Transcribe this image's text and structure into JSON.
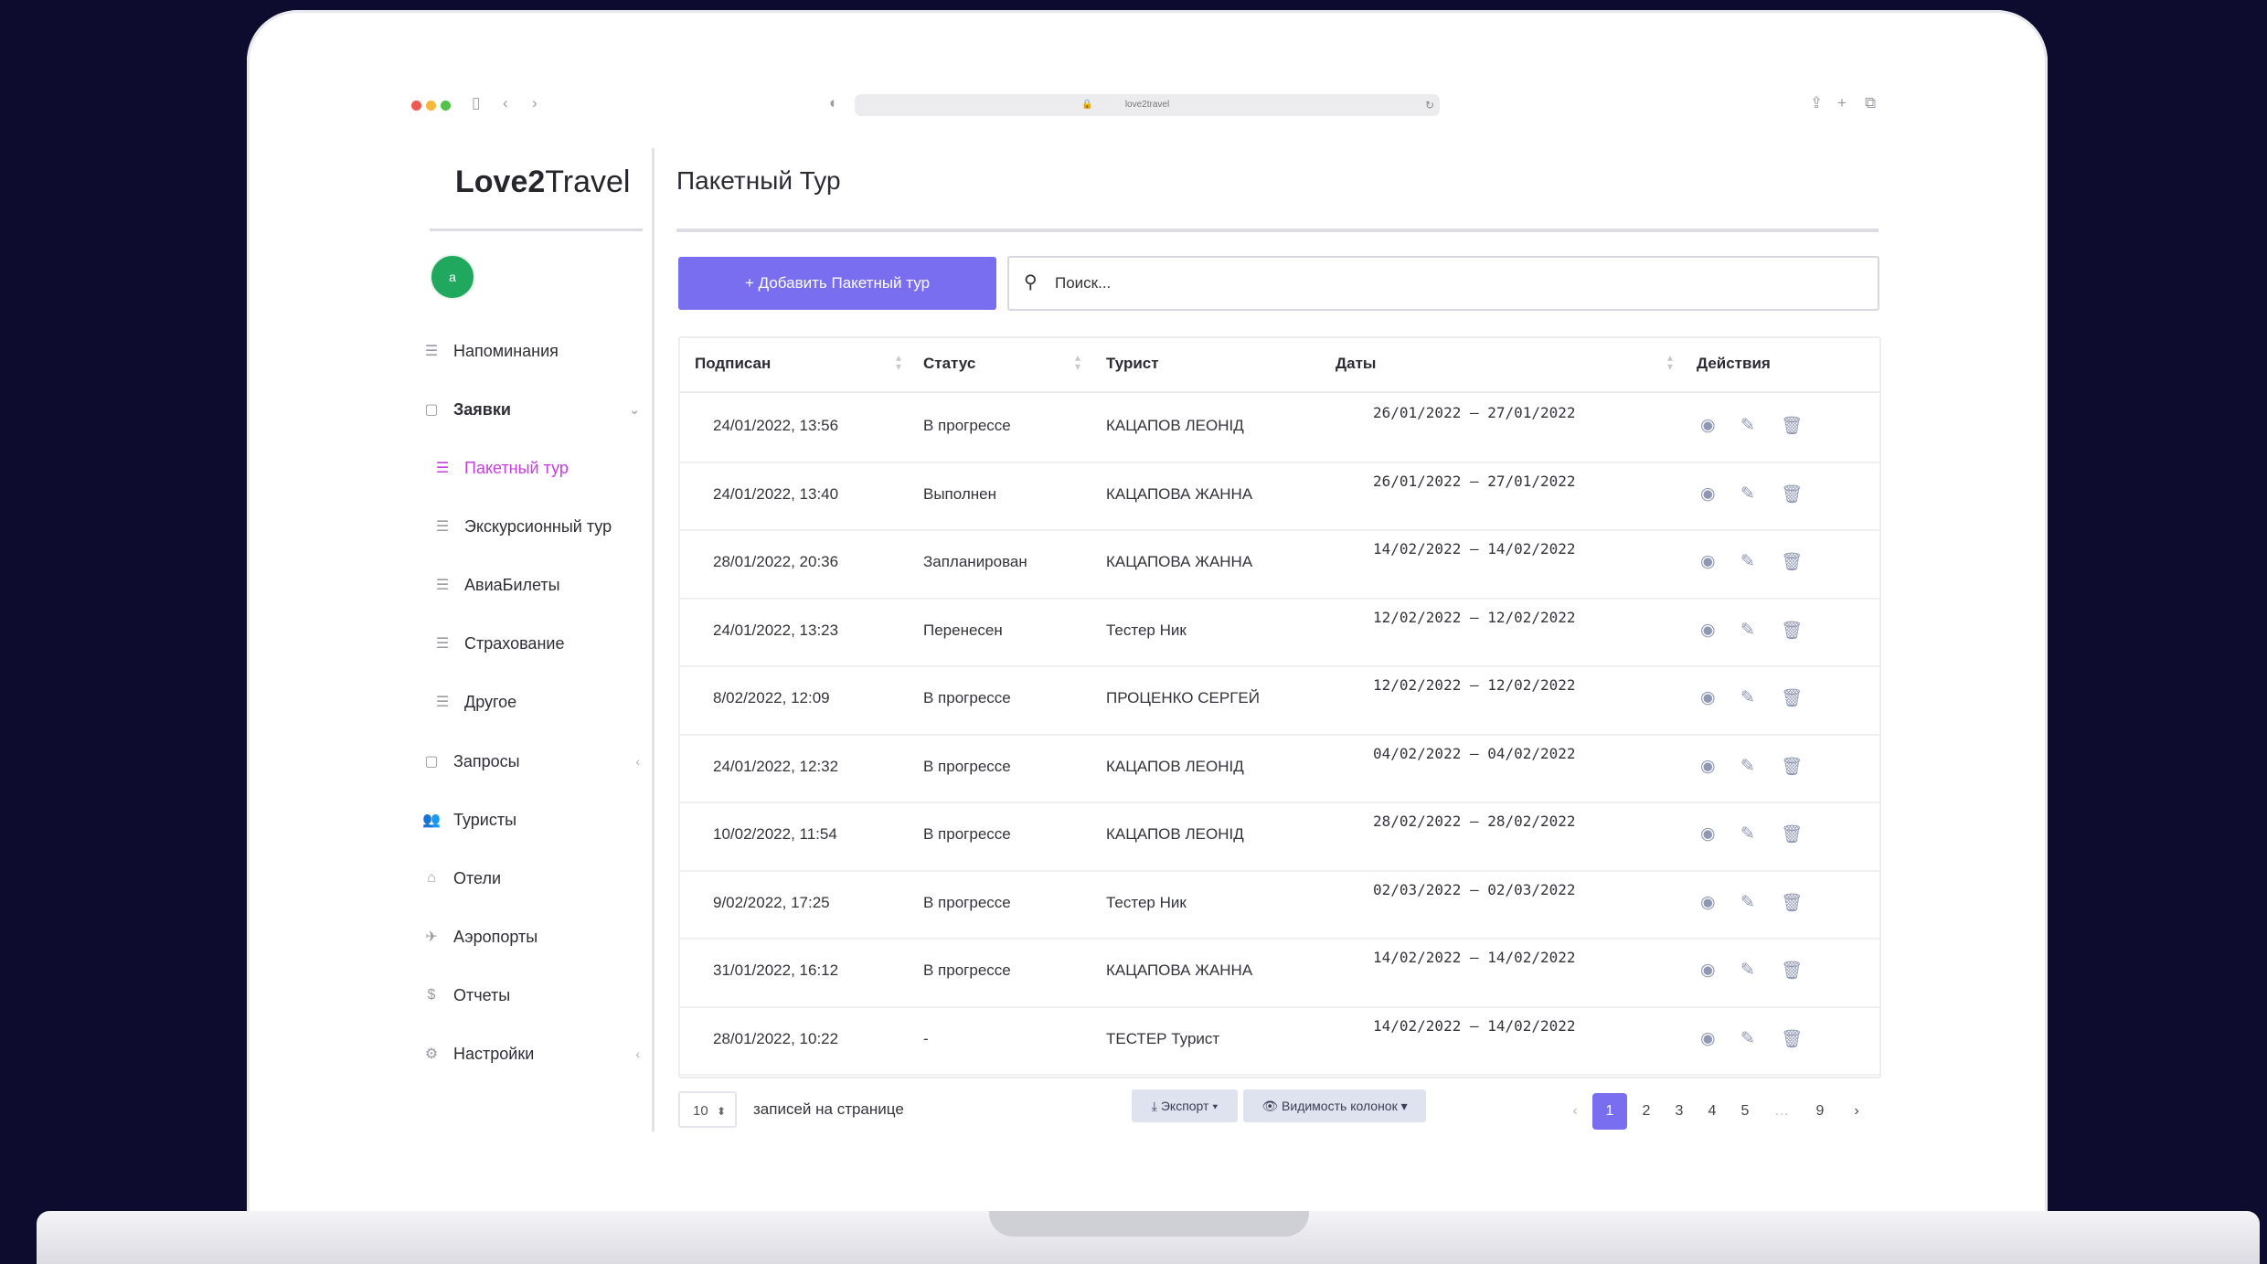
{
  "browser": {
    "url": "love2travel",
    "dot_colors": [
      "#ee5a52",
      "#f5b83d",
      "#52c24a"
    ]
  },
  "brand": {
    "name_bold": "Love2",
    "name_rest": "Travel"
  },
  "user": {
    "avatar_initial": "a"
  },
  "sidebar": {
    "items": [
      {
        "label": "Напоминания",
        "icon": "list-icon"
      },
      {
        "label": "Заявки",
        "icon": "folder-icon"
      },
      {
        "label": "Пакетный тур",
        "icon": "list-icon"
      },
      {
        "label": "Экскурсионный тур",
        "icon": "list-icon"
      },
      {
        "label": "АвиаБилеты",
        "icon": "list-icon"
      },
      {
        "label": "Страхование",
        "icon": "list-icon"
      },
      {
        "label": "Другое",
        "icon": "list-icon"
      },
      {
        "label": "Запросы",
        "icon": "folder-icon"
      },
      {
        "label": "Туристы",
        "icon": "users-icon"
      },
      {
        "label": "Отели",
        "icon": "home-icon"
      },
      {
        "label": "Аэропорты",
        "icon": "plane-icon"
      },
      {
        "label": "Отчеты",
        "icon": "dollar-icon"
      },
      {
        "label": "Настройки",
        "icon": "gear-icon"
      }
    ]
  },
  "main": {
    "title": "Пакетный Тур",
    "add_button": "+ Добавить Пакетный тур",
    "search_placeholder": "Поиск..."
  },
  "table": {
    "columns": [
      "Подписан",
      "Статус",
      "Турист",
      "Даты",
      "Действия"
    ],
    "rows": [
      {
        "signed": "24/01/2022, 13:56",
        "status": "В прогрессе",
        "tourist": "КАЦАПОВ ЛЕОНІД",
        "dates": "26/01/2022 – 27/01/2022"
      },
      {
        "signed": "24/01/2022, 13:40",
        "status": "Выполнен",
        "tourist": "КАЦАПОВА ЖАННА",
        "dates": "26/01/2022 – 27/01/2022"
      },
      {
        "signed": "28/01/2022, 20:36",
        "status": "Запланирован",
        "tourist": "КАЦАПОВА ЖАННА",
        "dates": "14/02/2022 – 14/02/2022"
      },
      {
        "signed": "24/01/2022, 13:23",
        "status": "Перенесен",
        "tourist": "Тестер Ник",
        "dates": "12/02/2022 – 12/02/2022"
      },
      {
        "signed": "8/02/2022, 12:09",
        "status": "В прогрессе",
        "tourist": "ПРОЦЕНКО СЕРГЕЙ",
        "dates": "12/02/2022 – 12/02/2022"
      },
      {
        "signed": "24/01/2022, 12:32",
        "status": "В прогрессе",
        "tourist": "КАЦАПОВ ЛЕОНІД",
        "dates": "04/02/2022 – 04/02/2022"
      },
      {
        "signed": "10/02/2022, 11:54",
        "status": "В прогрессе",
        "tourist": "КАЦАПОВ ЛЕОНІД",
        "dates": "28/02/2022 – 28/02/2022"
      },
      {
        "signed": "9/02/2022, 17:25",
        "status": "В прогрессе",
        "tourist": "Тестер Ник",
        "dates": "02/03/2022 – 02/03/2022"
      },
      {
        "signed": "31/01/2022, 16:12",
        "status": "В прогрессе",
        "tourist": "КАЦАПОВА ЖАННА",
        "dates": "14/02/2022 – 14/02/2022"
      },
      {
        "signed": "28/01/2022, 10:22",
        "status": "-",
        "tourist": "ТЕСТЕР Турист",
        "dates": "14/02/2022 – 14/02/2022"
      }
    ]
  },
  "footer": {
    "page_size": "10",
    "rows_per_page_label": "записей на странице",
    "export_label": "⤓ Экспорт ▾",
    "columns_label": "👁 Видимость колонок ▾",
    "pages": [
      "‹",
      "1",
      "2",
      "3",
      "4",
      "5",
      "…",
      "9",
      "›"
    ],
    "current_page": "1"
  },
  "colors": {
    "accent": "#7a6ef0",
    "active_nav": "#c43ee0",
    "avatar": "#1fa85e",
    "background": "#0d0b2e"
  }
}
